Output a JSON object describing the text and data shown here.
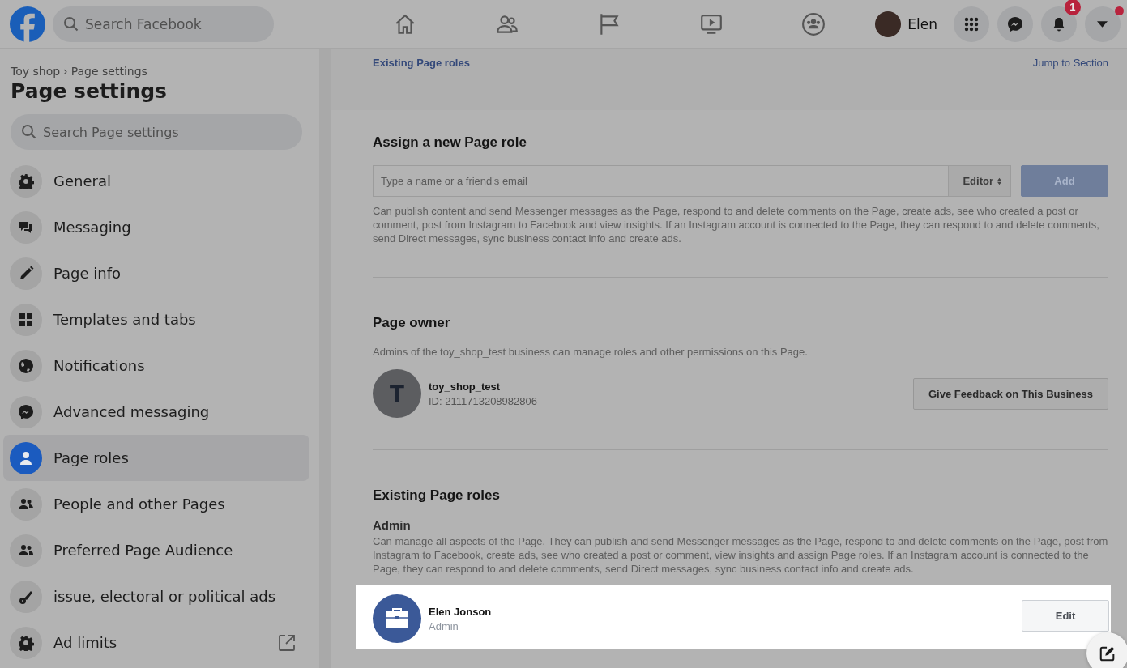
{
  "header": {
    "search": {
      "placeholder": "Search Facebook"
    },
    "user": {
      "name": "Elen"
    },
    "notifications": {
      "badge": "1"
    }
  },
  "sidebar": {
    "breadcrumb": [
      "Toy shop",
      "Page settings"
    ],
    "separator": "›",
    "title": "Page settings",
    "search": {
      "placeholder": "Search Page settings"
    },
    "items": [
      {
        "label": "General",
        "kind": "gear",
        "selected": false,
        "external": false
      },
      {
        "label": "Messaging",
        "kind": "chat",
        "selected": false,
        "external": false
      },
      {
        "label": "Page info",
        "kind": "pencil",
        "selected": false,
        "external": false
      },
      {
        "label": "Templates and tabs",
        "kind": "grid",
        "selected": false,
        "external": false
      },
      {
        "label": "Notifications",
        "kind": "globe",
        "selected": false,
        "external": false
      },
      {
        "label": "Advanced messaging",
        "kind": "messenger",
        "selected": false,
        "external": false
      },
      {
        "label": "Page roles",
        "kind": "person",
        "selected": true,
        "external": false
      },
      {
        "label": "People and other Pages",
        "kind": "people",
        "selected": false,
        "external": false
      },
      {
        "label": "Preferred Page Audience",
        "kind": "people",
        "selected": false,
        "external": false
      },
      {
        "label": "issue, electoral or political ads",
        "kind": "key",
        "selected": false,
        "external": false
      },
      {
        "label": "Ad limits",
        "kind": "gear",
        "selected": false,
        "external": true
      }
    ]
  },
  "top_bar": {
    "section_link": "Existing Page roles",
    "jump_link": "Jump to Section"
  },
  "assign": {
    "title": "Assign a new Page role",
    "input": {
      "placeholder": "Type a name or a friend's email"
    },
    "role_select": "Editor",
    "add_button": "Add",
    "add_disabled": true,
    "description": "Can publish content and send Messenger messages as the Page, respond to and delete comments on the Page, create ads, see who created a post or comment, post from Instagram to Facebook and view insights. If an Instagram account is connected to the Page, they can respond to and delete comments, send Direct messages, sync business contact info and create ads."
  },
  "owner": {
    "title": "Page owner",
    "description": "Admins of the toy_shop_test business can manage roles and other permissions on this Page.",
    "avatar_letter": "T",
    "name": "toy_shop_test",
    "id": "ID: 2111713208982806",
    "button": "Give Feedback on This Business"
  },
  "existing": {
    "title": "Existing Page roles",
    "role": "Admin",
    "description": "Can manage all aspects of the Page. They can publish and send Messenger messages as the Page, respond to and delete comments on the Page, post from Instagram to Facebook, create ads, see who created a post or comment, view insights and assign Page roles. If an Instagram account is connected to the Page, they can respond to and delete comments, send Direct messages, sync business contact info and create ads.",
    "members": [
      {
        "name": "Elen Jonson",
        "role": "Admin",
        "button": "Edit"
      }
    ]
  }
}
